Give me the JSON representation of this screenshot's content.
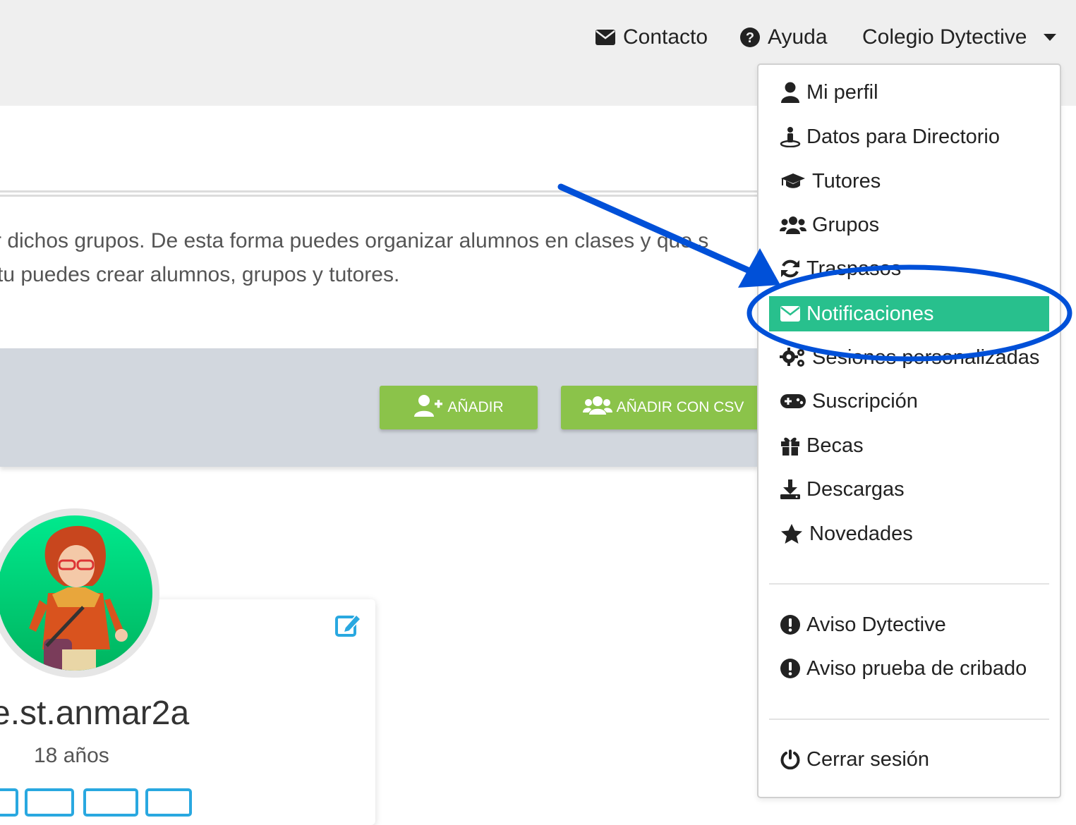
{
  "topnav": {
    "contact": "Contacto",
    "help": "Ayuda",
    "account": "Colegio Dytective"
  },
  "intro": {
    "line1": "r dichos grupos. De esta forma puedes organizar alumnos en clases y que s",
    "line2": "tu puedes crear alumnos, grupos y tutores."
  },
  "toolbar": {
    "add_label": "AÑADIR",
    "add_csv_label": "AÑADIR CON CSV"
  },
  "student": {
    "username": "e.st.anmar2a",
    "age": "18 años"
  },
  "menu": {
    "items": [
      {
        "label": "Mi perfil",
        "icon": "user-icon"
      },
      {
        "label": "Datos para Directorio",
        "icon": "directory-person-icon"
      },
      {
        "label": "Tutores",
        "icon": "graduation-cap-icon"
      },
      {
        "label": "Grupos",
        "icon": "users-icon"
      },
      {
        "label": "Traspasos",
        "icon": "sync-icon"
      },
      {
        "label": "Notificaciones",
        "icon": "envelope-icon",
        "active": true
      },
      {
        "label": "Sesiones personalizadas",
        "icon": "cogs-icon"
      },
      {
        "label": "Suscripción",
        "icon": "gamepad-icon"
      },
      {
        "label": "Becas",
        "icon": "gift-icon"
      },
      {
        "label": "Descargas",
        "icon": "download-icon"
      },
      {
        "label": "Novedades",
        "icon": "star-icon"
      }
    ],
    "alerts": [
      {
        "label": "Aviso Dytective",
        "icon": "exclamation-circle-icon"
      },
      {
        "label": "Aviso prueba de cribado",
        "icon": "exclamation-circle-icon"
      }
    ],
    "logout": {
      "label": "Cerrar sesión",
      "icon": "power-icon"
    }
  },
  "colors": {
    "active_item": "#28c08d",
    "add_button": "#8bc34a",
    "annotation": "#0050d8",
    "edit_icon": "#29a8e0"
  }
}
